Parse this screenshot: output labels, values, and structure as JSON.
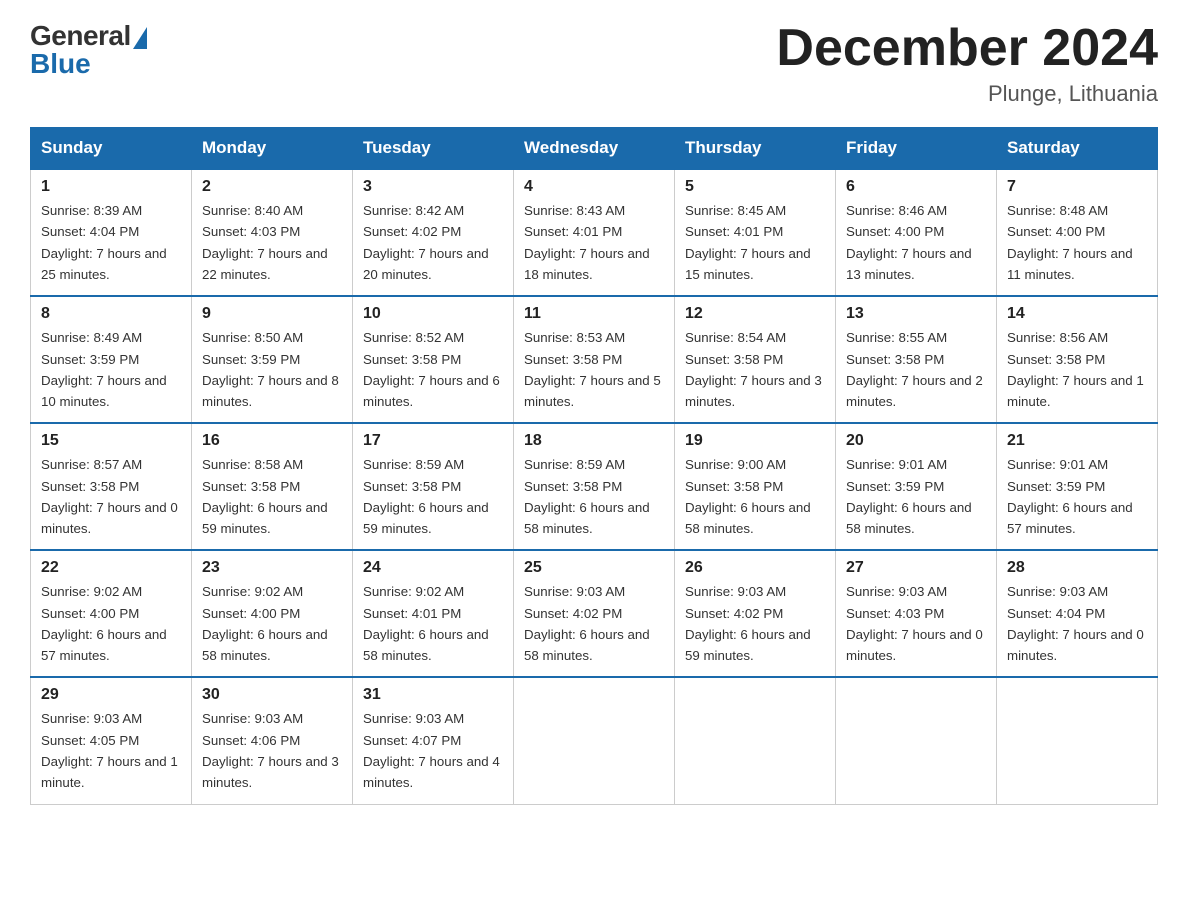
{
  "header": {
    "logo_general": "General",
    "logo_blue": "Blue",
    "month_title": "December 2024",
    "location": "Plunge, Lithuania"
  },
  "days_of_week": [
    "Sunday",
    "Monday",
    "Tuesday",
    "Wednesday",
    "Thursday",
    "Friday",
    "Saturday"
  ],
  "weeks": [
    [
      {
        "day": "1",
        "sunrise": "8:39 AM",
        "sunset": "4:04 PM",
        "daylight": "7 hours and 25 minutes."
      },
      {
        "day": "2",
        "sunrise": "8:40 AM",
        "sunset": "4:03 PM",
        "daylight": "7 hours and 22 minutes."
      },
      {
        "day": "3",
        "sunrise": "8:42 AM",
        "sunset": "4:02 PM",
        "daylight": "7 hours and 20 minutes."
      },
      {
        "day": "4",
        "sunrise": "8:43 AM",
        "sunset": "4:01 PM",
        "daylight": "7 hours and 18 minutes."
      },
      {
        "day": "5",
        "sunrise": "8:45 AM",
        "sunset": "4:01 PM",
        "daylight": "7 hours and 15 minutes."
      },
      {
        "day": "6",
        "sunrise": "8:46 AM",
        "sunset": "4:00 PM",
        "daylight": "7 hours and 13 minutes."
      },
      {
        "day": "7",
        "sunrise": "8:48 AM",
        "sunset": "4:00 PM",
        "daylight": "7 hours and 11 minutes."
      }
    ],
    [
      {
        "day": "8",
        "sunrise": "8:49 AM",
        "sunset": "3:59 PM",
        "daylight": "7 hours and 10 minutes."
      },
      {
        "day": "9",
        "sunrise": "8:50 AM",
        "sunset": "3:59 PM",
        "daylight": "7 hours and 8 minutes."
      },
      {
        "day": "10",
        "sunrise": "8:52 AM",
        "sunset": "3:58 PM",
        "daylight": "7 hours and 6 minutes."
      },
      {
        "day": "11",
        "sunrise": "8:53 AM",
        "sunset": "3:58 PM",
        "daylight": "7 hours and 5 minutes."
      },
      {
        "day": "12",
        "sunrise": "8:54 AM",
        "sunset": "3:58 PM",
        "daylight": "7 hours and 3 minutes."
      },
      {
        "day": "13",
        "sunrise": "8:55 AM",
        "sunset": "3:58 PM",
        "daylight": "7 hours and 2 minutes."
      },
      {
        "day": "14",
        "sunrise": "8:56 AM",
        "sunset": "3:58 PM",
        "daylight": "7 hours and 1 minute."
      }
    ],
    [
      {
        "day": "15",
        "sunrise": "8:57 AM",
        "sunset": "3:58 PM",
        "daylight": "7 hours and 0 minutes."
      },
      {
        "day": "16",
        "sunrise": "8:58 AM",
        "sunset": "3:58 PM",
        "daylight": "6 hours and 59 minutes."
      },
      {
        "day": "17",
        "sunrise": "8:59 AM",
        "sunset": "3:58 PM",
        "daylight": "6 hours and 59 minutes."
      },
      {
        "day": "18",
        "sunrise": "8:59 AM",
        "sunset": "3:58 PM",
        "daylight": "6 hours and 58 minutes."
      },
      {
        "day": "19",
        "sunrise": "9:00 AM",
        "sunset": "3:58 PM",
        "daylight": "6 hours and 58 minutes."
      },
      {
        "day": "20",
        "sunrise": "9:01 AM",
        "sunset": "3:59 PM",
        "daylight": "6 hours and 58 minutes."
      },
      {
        "day": "21",
        "sunrise": "9:01 AM",
        "sunset": "3:59 PM",
        "daylight": "6 hours and 57 minutes."
      }
    ],
    [
      {
        "day": "22",
        "sunrise": "9:02 AM",
        "sunset": "4:00 PM",
        "daylight": "6 hours and 57 minutes."
      },
      {
        "day": "23",
        "sunrise": "9:02 AM",
        "sunset": "4:00 PM",
        "daylight": "6 hours and 58 minutes."
      },
      {
        "day": "24",
        "sunrise": "9:02 AM",
        "sunset": "4:01 PM",
        "daylight": "6 hours and 58 minutes."
      },
      {
        "day": "25",
        "sunrise": "9:03 AM",
        "sunset": "4:02 PM",
        "daylight": "6 hours and 58 minutes."
      },
      {
        "day": "26",
        "sunrise": "9:03 AM",
        "sunset": "4:02 PM",
        "daylight": "6 hours and 59 minutes."
      },
      {
        "day": "27",
        "sunrise": "9:03 AM",
        "sunset": "4:03 PM",
        "daylight": "7 hours and 0 minutes."
      },
      {
        "day": "28",
        "sunrise": "9:03 AM",
        "sunset": "4:04 PM",
        "daylight": "7 hours and 0 minutes."
      }
    ],
    [
      {
        "day": "29",
        "sunrise": "9:03 AM",
        "sunset": "4:05 PM",
        "daylight": "7 hours and 1 minute."
      },
      {
        "day": "30",
        "sunrise": "9:03 AM",
        "sunset": "4:06 PM",
        "daylight": "7 hours and 3 minutes."
      },
      {
        "day": "31",
        "sunrise": "9:03 AM",
        "sunset": "4:07 PM",
        "daylight": "7 hours and 4 minutes."
      },
      null,
      null,
      null,
      null
    ]
  ]
}
